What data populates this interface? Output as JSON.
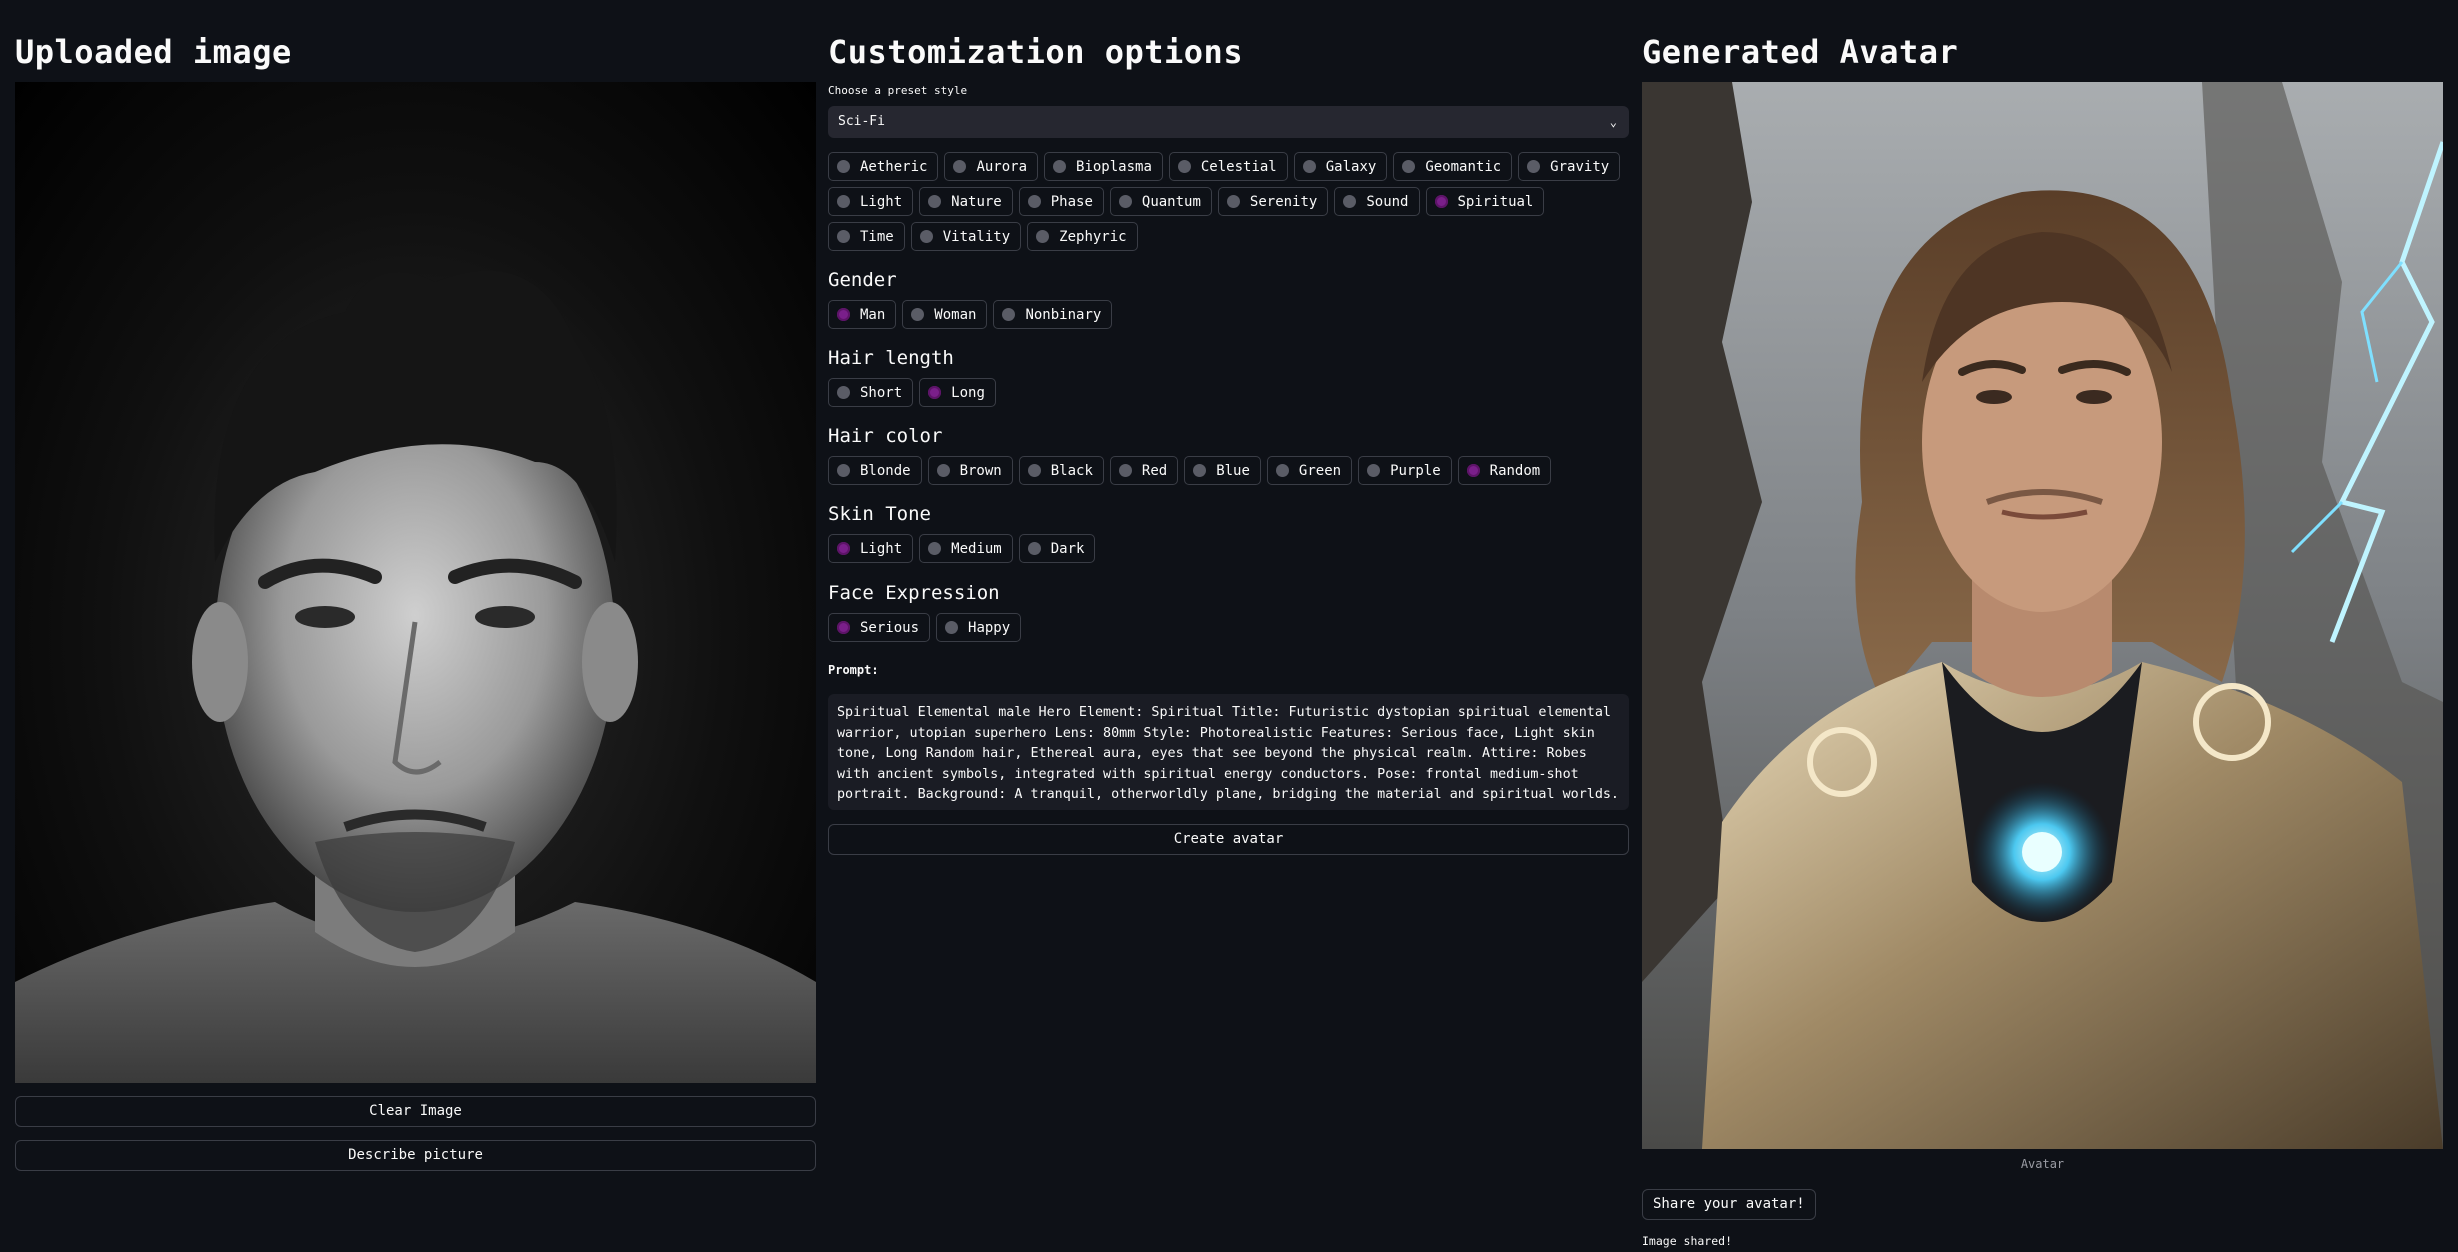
{
  "left": {
    "title": "Uploaded image",
    "clear_label": "Clear Image",
    "describe_label": "Describe picture"
  },
  "middle": {
    "title": "Customization options",
    "preset_label": "Choose a preset style",
    "preset_value": "Sci-Fi",
    "elements": [
      {
        "label": "Aetheric",
        "selected": false
      },
      {
        "label": "Aurora",
        "selected": false
      },
      {
        "label": "Bioplasma",
        "selected": false
      },
      {
        "label": "Celestial",
        "selected": false
      },
      {
        "label": "Galaxy",
        "selected": false
      },
      {
        "label": "Geomantic",
        "selected": false
      },
      {
        "label": "Gravity",
        "selected": false
      },
      {
        "label": "Light",
        "selected": false
      },
      {
        "label": "Nature",
        "selected": false
      },
      {
        "label": "Phase",
        "selected": false
      },
      {
        "label": "Quantum",
        "selected": false
      },
      {
        "label": "Serenity",
        "selected": false
      },
      {
        "label": "Sound",
        "selected": false
      },
      {
        "label": "Spiritual",
        "selected": true
      },
      {
        "label": "Time",
        "selected": false
      },
      {
        "label": "Vitality",
        "selected": false
      },
      {
        "label": "Zephyric",
        "selected": false
      }
    ],
    "gender": {
      "title": "Gender",
      "options": [
        {
          "label": "Man",
          "selected": true
        },
        {
          "label": "Woman",
          "selected": false
        },
        {
          "label": "Nonbinary",
          "selected": false
        }
      ]
    },
    "hair_length": {
      "title": "Hair length",
      "options": [
        {
          "label": "Short",
          "selected": false
        },
        {
          "label": "Long",
          "selected": true
        }
      ]
    },
    "hair_color": {
      "title": "Hair color",
      "options": [
        {
          "label": "Blonde",
          "selected": false
        },
        {
          "label": "Brown",
          "selected": false
        },
        {
          "label": "Black",
          "selected": false
        },
        {
          "label": "Red",
          "selected": false
        },
        {
          "label": "Blue",
          "selected": false
        },
        {
          "label": "Green",
          "selected": false
        },
        {
          "label": "Purple",
          "selected": false
        },
        {
          "label": "Random",
          "selected": true
        }
      ]
    },
    "skin_tone": {
      "title": "Skin Tone",
      "options": [
        {
          "label": "Light",
          "selected": true
        },
        {
          "label": "Medium",
          "selected": false
        },
        {
          "label": "Dark",
          "selected": false
        }
      ]
    },
    "face_expression": {
      "title": "Face Expression",
      "options": [
        {
          "label": "Serious",
          "selected": true
        },
        {
          "label": "Happy",
          "selected": false
        }
      ]
    },
    "prompt_label": "Prompt:",
    "prompt_text": "Spiritual Elemental male Hero Element: Spiritual Title: Futuristic dystopian spiritual elemental warrior, utopian superhero Lens: 80mm Style: Photorealistic Features: Serious face, Light skin tone, Long Random hair, Ethereal aura, eyes that see beyond the physical realm. Attire: Robes with ancient symbols, integrated with spiritual energy conductors. Pose: frontal medium-shot portrait. Background: A tranquil, otherworldly plane, bridging the material and spiritual worlds.",
    "create_label": "Create avatar"
  },
  "right": {
    "title": "Generated Avatar",
    "caption": "Avatar",
    "share_label": "Share your avatar!",
    "shared_note": "Image shared!"
  },
  "colors": {
    "background": "#0e1117",
    "selected_radio": "#7a1f8a",
    "unselected_radio": "#5a5c66",
    "border": "#3a3d46"
  }
}
